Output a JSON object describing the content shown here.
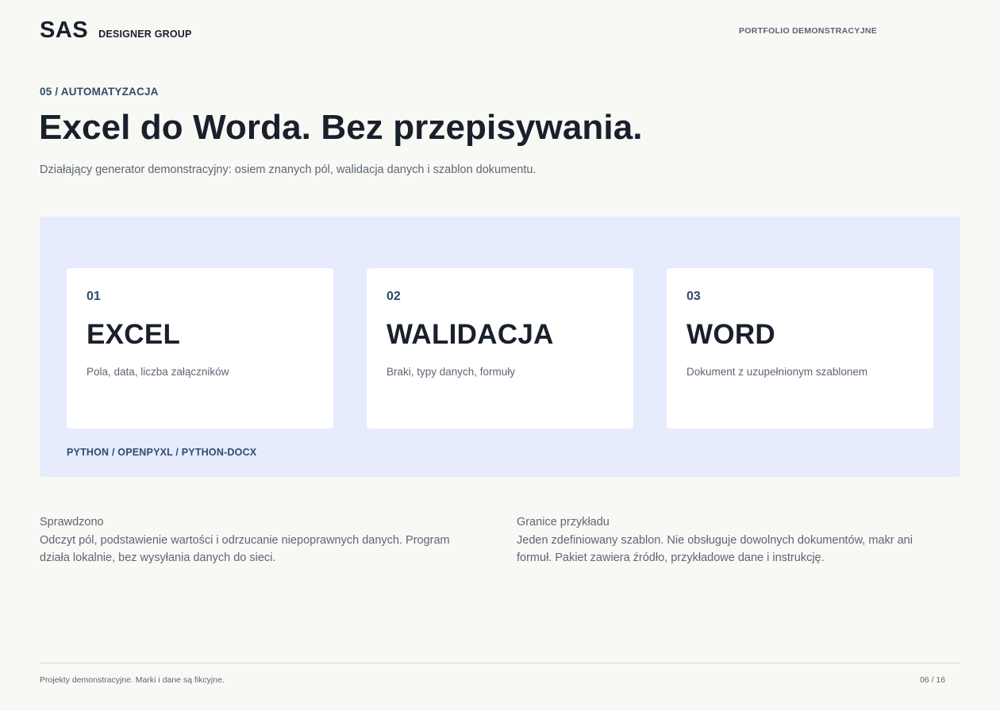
{
  "header": {
    "logo": "SAS",
    "brand_sub": "DESIGNER GROUP",
    "right_label": "PORTFOLIO DEMONSTRACYJNE"
  },
  "section": {
    "kicker": "05 / AUTOMATYZACJA",
    "title": "Excel do Worda. Bez przepisywania.",
    "subtitle": "Działający generator demonstracyjny: osiem znanych pól, walidacja danych i szablon dokumentu."
  },
  "pipeline": {
    "cards": [
      {
        "number": "01",
        "title": "EXCEL",
        "description": "Pola, data, liczba załączników"
      },
      {
        "number": "02",
        "title": "WALIDACJA",
        "description": "Braki, typy danych, formuły"
      },
      {
        "number": "03",
        "title": "WORD",
        "description": "Dokument z uzupełnionym szablonem"
      }
    ],
    "stack": "PYTHON / OPENPYXL / PYTHON-DOCX"
  },
  "notes": {
    "left": {
      "title": "Sprawdzono",
      "text": "Odczyt pól, podstawienie wartości i odrzucanie niepoprawnych danych. Program działa lokalnie, bez wysyłania danych do sieci."
    },
    "right": {
      "title": "Granice przykładu",
      "text": "Jeden zdefiniowany szablon. Nie obsługuje dowolnych dokumentów, makr ani formuł. Pakiet zawiera źródło, przykładowe dane i instrukcję."
    }
  },
  "footer": {
    "disclaimer": "Projekty demonstracyjne. Marki i dane są fikcyjne.",
    "page": "06 / 16"
  }
}
